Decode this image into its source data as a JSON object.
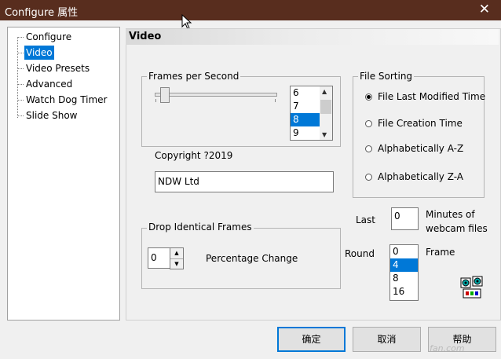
{
  "window": {
    "title": "Configure 属性",
    "close_glyph": "✕"
  },
  "nav": {
    "items": [
      {
        "label": "Configure",
        "selected": false
      },
      {
        "label": "Video",
        "selected": true
      },
      {
        "label": "Video Presets",
        "selected": false
      },
      {
        "label": "Advanced",
        "selected": false
      },
      {
        "label": "Watch Dog Timer",
        "selected": false
      },
      {
        "label": "Slide Show",
        "selected": false
      }
    ]
  },
  "panel": {
    "title": "Video"
  },
  "frames_per_second": {
    "group_label": "Frames per Second",
    "slider_level_fraction": 0.05,
    "options": [
      "6",
      "7",
      "8",
      "9"
    ],
    "selected": "8"
  },
  "copyright": {
    "label": "Copyright ?2019",
    "company_value": "NDW Ltd"
  },
  "file_sorting": {
    "group_label": "File Sorting",
    "options": [
      {
        "label": "File Last Modified Time",
        "checked": true
      },
      {
        "label": "File Creation Time",
        "checked": false
      },
      {
        "label": "Alphabetically A-Z",
        "checked": false
      },
      {
        "label": "Alphabetically Z-A",
        "checked": false
      }
    ]
  },
  "drop_frames": {
    "group_label": "Drop Identical Frames",
    "spinner_value": "0",
    "unit_label": "Percentage Change"
  },
  "last": {
    "label": "Last",
    "value": "0",
    "suffix_line1": "Minutes of",
    "suffix_line2": "webcam files"
  },
  "round": {
    "label": "Round",
    "options": [
      "0",
      "4",
      "8",
      "16"
    ],
    "selected": "4",
    "unit_label": "Frame"
  },
  "buttons": {
    "ok": "确定",
    "cancel": "取消",
    "help": "帮助"
  },
  "watermark": "fan.com",
  "icons": [
    "close-icon",
    "cursor-arrow-icon",
    "up-arrow-icon",
    "down-arrow-icon",
    "webcam-film-icon"
  ],
  "colors": {
    "titlebar": "#582d1e",
    "selection": "#0078d7",
    "default_button_border": "#0078d7"
  }
}
